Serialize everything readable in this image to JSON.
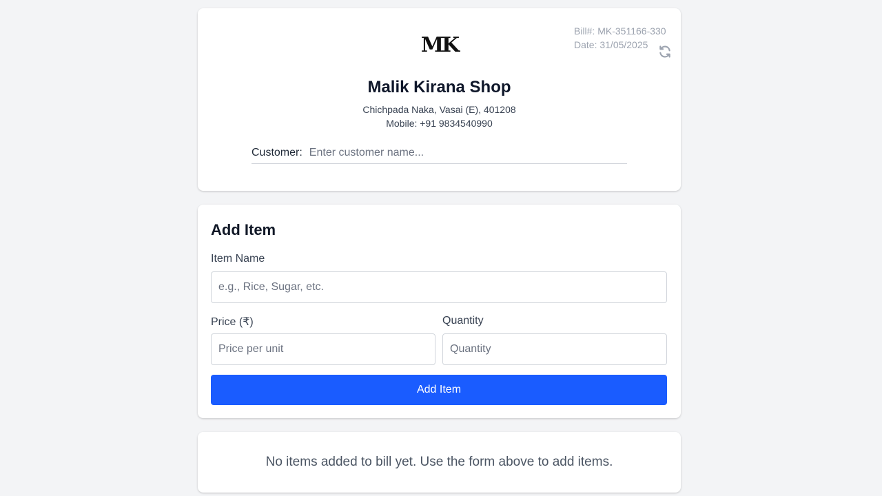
{
  "header": {
    "bill_no": "Bill#: MK-351166-330",
    "date": "Date: 31/05/2025",
    "refresh_icon": "refresh-icon",
    "logo_text": "MK",
    "shop_name": "Malik Kirana Shop",
    "address": "Chichpada Naka, Vasai (E), 401208",
    "mobile": "Mobile: +91 9834540990",
    "customer_label": "Customer:",
    "customer_placeholder": "Enter customer name...",
    "customer_value": ""
  },
  "add_item": {
    "title": "Add Item",
    "item_name_label": "Item Name",
    "item_name_placeholder": "e.g., Rice, Sugar, etc.",
    "price_label": "Price (₹)",
    "price_placeholder": "Price per unit",
    "quantity_label": "Quantity",
    "quantity_placeholder": "Quantity",
    "button_label": "Add Item"
  },
  "bill_items": {
    "empty_message": "No items added to bill yet. Use the form above to add items."
  },
  "colors": {
    "accent": "#1a5cff",
    "background": "#f3f4f6"
  }
}
